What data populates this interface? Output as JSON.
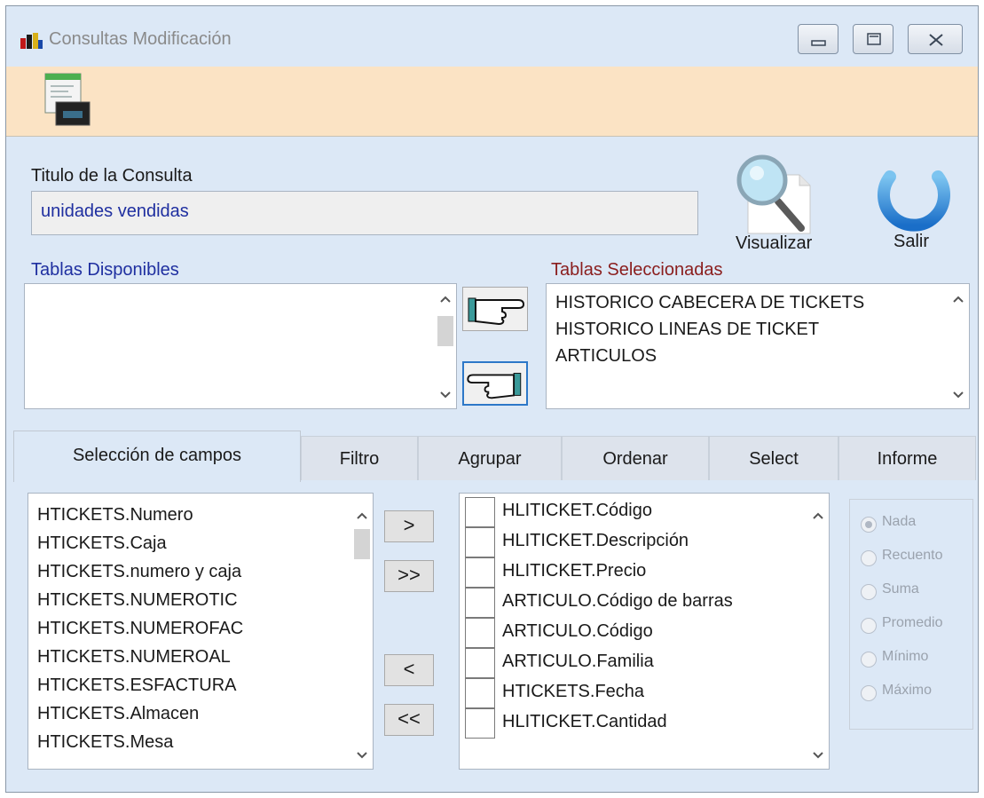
{
  "window": {
    "title": "Consultas Modificación",
    "minimize_icon": "minimize-icon",
    "maximize_icon": "maximize-icon",
    "close_icon": "close-icon"
  },
  "toolbar": {
    "icon": "query-editor-icon"
  },
  "form": {
    "title_label": "Titulo de la Consulta",
    "title_value": "unidades vendidas",
    "visualize_label": "Visualizar",
    "exit_label": "Salir",
    "available_label": "Tablas Disponibles",
    "selected_label": "Tablas Seleccionadas",
    "available_tables": [],
    "selected_tables": [
      "HISTORICO CABECERA DE TICKETS",
      "HISTORICO LINEAS DE TICKET",
      "ARTICULOS"
    ]
  },
  "tabs": [
    {
      "label": "Selección de campos",
      "active": true
    },
    {
      "label": "Filtro"
    },
    {
      "label": "Agrupar"
    },
    {
      "label": "Ordenar"
    },
    {
      "label": "Select"
    },
    {
      "label": "Informe"
    }
  ],
  "fields": {
    "available": [
      "HTICKETS.Numero",
      "HTICKETS.Caja",
      "HTICKETS.numero y caja",
      "HTICKETS.NUMEROTIC",
      "HTICKETS.NUMEROFAC",
      "HTICKETS.NUMEROAL",
      "HTICKETS.ESFACTURA",
      "HTICKETS.Almacen",
      "HTICKETS.Mesa"
    ],
    "buttons": {
      "add_one": ">",
      "add_all": ">>",
      "remove_one": "<",
      "remove_all": "<<"
    },
    "selected": [
      "HLITICKET.Código",
      "HLITICKET.Descripción",
      "HLITICKET.Precio",
      "ARTICULO.Código de barras",
      "ARTICULO.Código",
      "ARTICULO.Familia",
      "HTICKETS.Fecha",
      "HLITICKET.Cantidad"
    ]
  },
  "aggregate": {
    "options": [
      "Nada",
      "Recuento",
      "Suma",
      "Promedio",
      "Mínimo",
      "Máximo"
    ],
    "selected": "Nada"
  }
}
